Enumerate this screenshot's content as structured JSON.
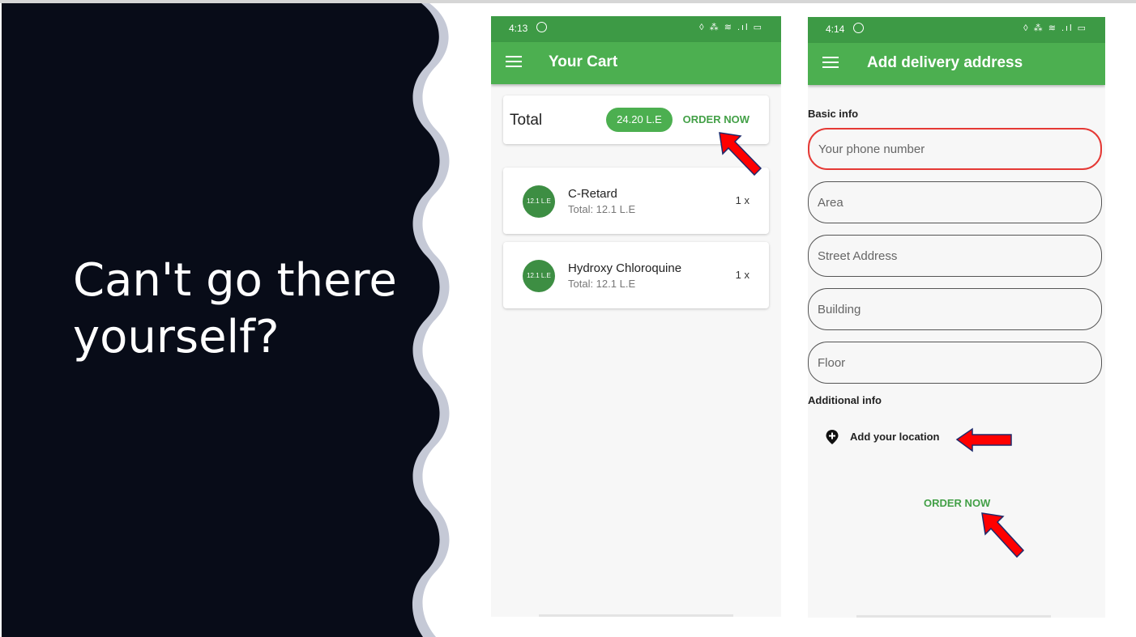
{
  "slide": {
    "headline": "Can't go there yourself?",
    "colors": {
      "left_panel": "#080c18",
      "wave": "#c5c9d6",
      "accent_green": "#4caf50",
      "arrow": "#ff0000"
    }
  },
  "cart_screen": {
    "status_time": "4:13",
    "status_icons": "◊ ⁂ ≋ .ıl ▭",
    "title": "Your Cart",
    "total_label": "Total",
    "total_value": "24.20 L.E",
    "order_now": "ORDER NOW",
    "items": [
      {
        "avatar": "12.1 L.E",
        "name": "C-Retard",
        "subtitle": "Total: 12.1 L.E",
        "qty": "1 x"
      },
      {
        "avatar": "12.1 L.E",
        "name": "Hydroxy Chloroquine",
        "subtitle": "Total: 12.1 L.E",
        "qty": "1 x"
      }
    ]
  },
  "address_screen": {
    "status_time": "4:14",
    "status_icons": "◊ ⁂ ≋ .ıl ▭",
    "title": "Add delivery address",
    "basic_info": "Basic info",
    "fields": {
      "phone": "Your phone number",
      "area": "Area",
      "street": "Street Address",
      "building": "Building",
      "floor": "Floor"
    },
    "additional_info": "Additional info",
    "add_location": "Add your location",
    "order_now": "ORDER NOW"
  },
  "icons": [
    "menu-icon",
    "whatsapp-icon",
    "add-location-icon",
    "red-arrow-icon"
  ]
}
